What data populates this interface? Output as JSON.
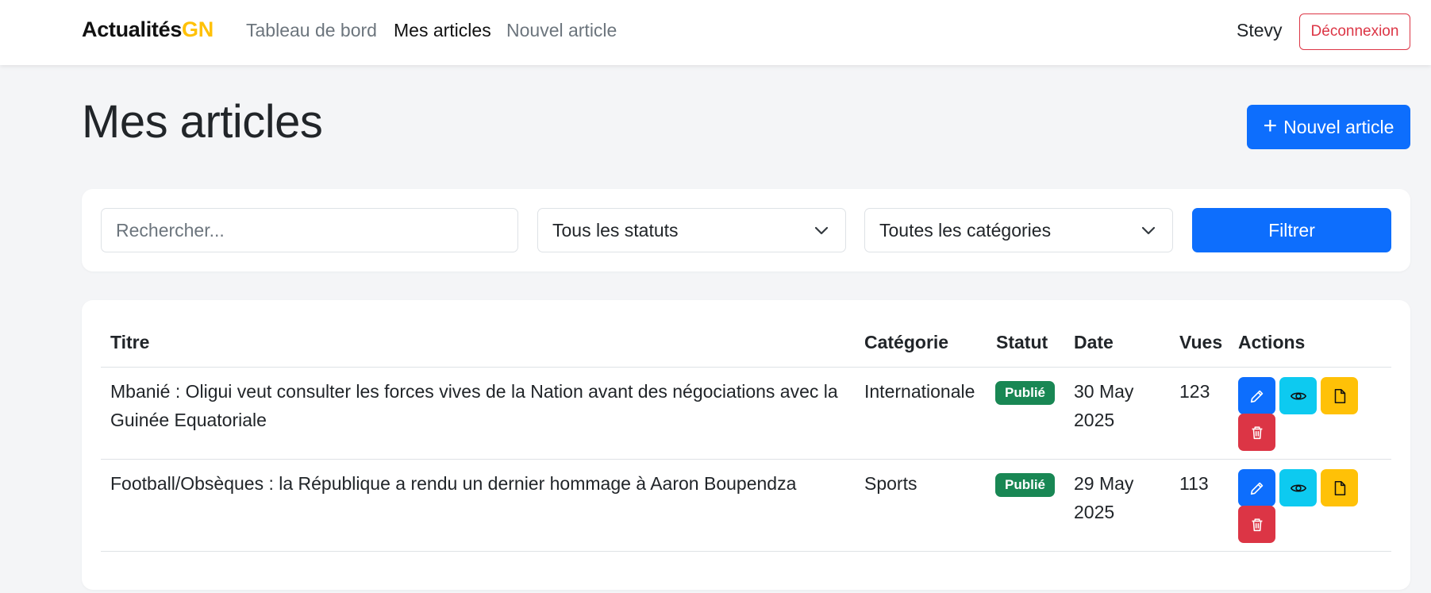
{
  "navbar": {
    "brand_main": "Actualités",
    "brand_accent": "GN",
    "links": [
      "Tableau de bord",
      "Mes articles",
      "Nouvel article"
    ],
    "user": "Stevy",
    "logout_label": "Déconnexion"
  },
  "page": {
    "title": "Mes articles",
    "new_article_label": "Nouvel article"
  },
  "filters": {
    "search_placeholder": "Rechercher...",
    "status_selected": "Tous les statuts",
    "category_selected": "Toutes les catégories",
    "filter_label": "Filtrer"
  },
  "table": {
    "headers": [
      "Titre",
      "Catégorie",
      "Statut",
      "Date",
      "Vues",
      "Actions"
    ],
    "rows": [
      {
        "title_line1": "Mbanié : Oligui veut consulter les forces vives de la Nation avant des négociations avec la",
        "title_line2": "Guinée Equatoriale",
        "category": "Internationale",
        "status": "Publié",
        "date_line1": "30 May",
        "date_line2": "2025",
        "views": "123"
      },
      {
        "title_line1": "Football/Obsèques : la République a rendu un dernier hommage à Aaron Boupendza",
        "title_line2": "",
        "category": "Sports",
        "status": "Publié",
        "date_line1": "29 May",
        "date_line2": "2025",
        "views": "113"
      }
    ]
  },
  "icons": {
    "edit": "pencil-icon",
    "view": "eye-icon",
    "document": "file-icon",
    "delete": "trash-icon"
  },
  "colors": {
    "primary": "#0d6efd",
    "info": "#0dcaf0",
    "warning": "#ffc107",
    "danger": "#dc3545",
    "success": "#198754",
    "brand_accent": "#ffc107"
  }
}
